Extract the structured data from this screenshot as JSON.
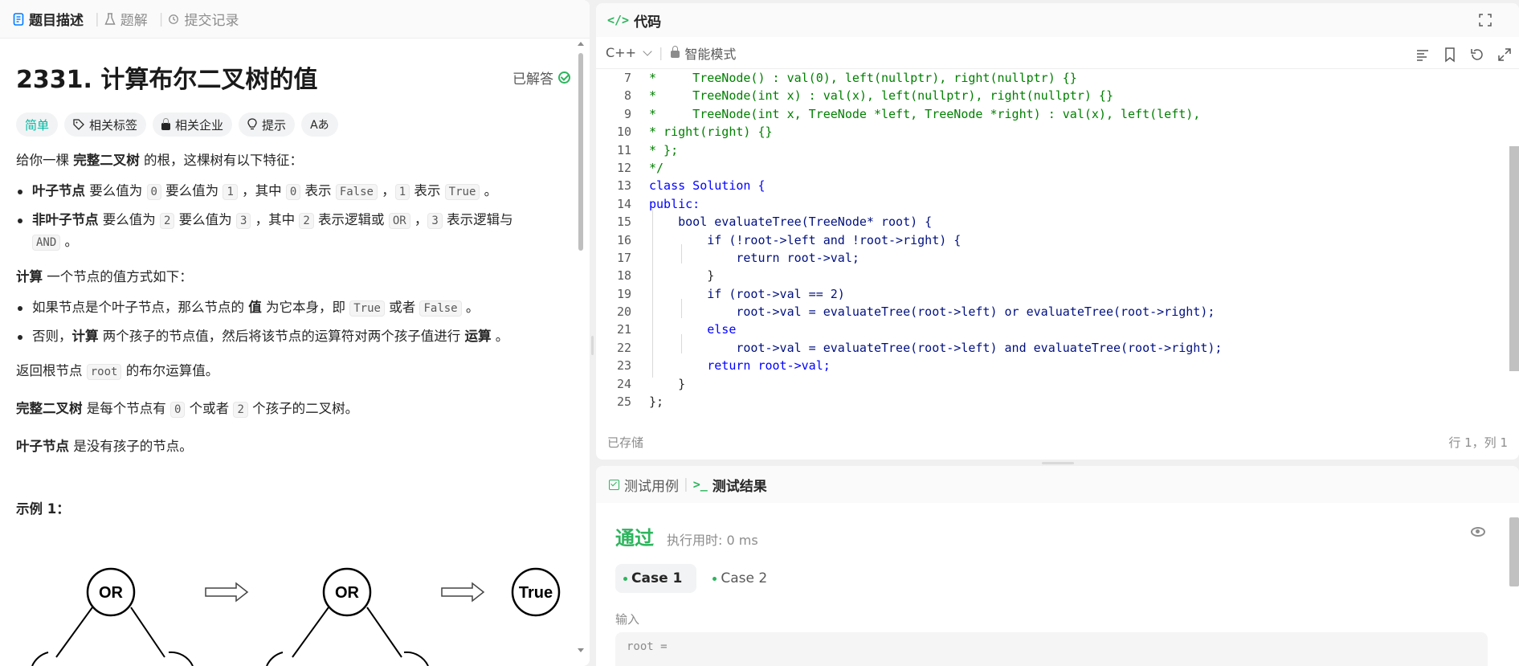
{
  "left_tabs": [
    {
      "label": "题目描述"
    },
    {
      "label": "题解"
    },
    {
      "label": "提交记录"
    }
  ],
  "problem": {
    "title": "2331. 计算布尔二叉树的值",
    "status": "已解答",
    "tags": [
      "简单",
      "相关标签",
      "相关企业",
      "提示",
      "Aあ"
    ],
    "intro_pre": "给你一棵 ",
    "intro_bold": "完整二叉树",
    "intro_post": " 的根，这棵树有以下特征：",
    "b1_bold": "叶子节点",
    "b1_t1": " 要么值为 ",
    "b1_c1": "0",
    "b1_t2": " 要么值为 ",
    "b1_c2": "1",
    "b1_t3": " ，其中 ",
    "b1_c3": "0",
    "b1_t4": " 表示 ",
    "b1_c4": "False",
    "b1_t5": " ，",
    "b1_c5": "1",
    "b1_t6": " 表示 ",
    "b1_c6": "True",
    "b1_t7": " 。",
    "b2_bold": "非叶子节点",
    "b2_t1": " 要么值为 ",
    "b2_c1": "2",
    "b2_t2": " 要么值为 ",
    "b2_c2": "3",
    "b2_t3": " ，其中 ",
    "b2_c3": "2",
    "b2_t4": " 表示逻辑或 ",
    "b2_c4": "OR",
    "b2_t5": " ，",
    "b2_c5": "3",
    "b2_t6": " 表示逻辑与 ",
    "b2_c6": "AND",
    "b2_t7": " 。",
    "calc_bold": "计算",
    "calc_post": " 一个节点的值方式如下：",
    "c1_t1": "如果节点是个叶子节点，那么节点的 ",
    "c1_bold": "值",
    "c1_t2": " 为它本身，即 ",
    "c1_c1": "True",
    "c1_t3": " 或者 ",
    "c1_c2": "False",
    "c1_t4": " 。",
    "c2_t1": "否则，",
    "c2_bold": "计算",
    "c2_t2": " 两个孩子的节点值，然后将该节点的运算符对两个孩子值进行 ",
    "c2_bold2": "运算",
    "c2_t3": " 。",
    "ret_t1": "返回根节点 ",
    "ret_c": "root",
    "ret_t2": " 的布尔运算值。",
    "full_bold": "完整二叉树",
    "full_t1": " 是每个节点有 ",
    "full_c1": "0",
    "full_t2": " 个或者 ",
    "full_c2": "2",
    "full_t3": " 个孩子的二叉树。",
    "leaf_bold": "叶子节点",
    "leaf_t1": " 是没有孩子的节点。",
    "example_title": "示例 1：",
    "diagram_nodes": [
      "OR",
      "OR",
      "True"
    ]
  },
  "code_panel": {
    "title": "代码",
    "language": "C++",
    "mode": "智能模式",
    "saved": "已存储",
    "cursor": "行 1，列 1",
    "lines": [
      {
        "n": "7",
        "text": "*     TreeNode() : val(0), left(nullptr), right(nullptr) {}"
      },
      {
        "n": "8",
        "text": "*     TreeNode(int x) : val(x), left(nullptr), right(nullptr) {}"
      },
      {
        "n": "9",
        "text": "*     TreeNode(int x, TreeNode *left, TreeNode *right) : val(x), left(left),"
      },
      {
        "n": "10",
        "text": "* right(right) {}"
      },
      {
        "n": "11",
        "text": "* };"
      },
      {
        "n": "12",
        "text": "*/"
      },
      {
        "n": "13",
        "text": "class Solution {"
      },
      {
        "n": "14",
        "text": "public:"
      },
      {
        "n": "15",
        "text": "    bool evaluateTree(TreeNode* root) {"
      },
      {
        "n": "16",
        "text": "        if (!root->left and !root->right) {"
      },
      {
        "n": "17",
        "text": "            return root->val;"
      },
      {
        "n": "18",
        "text": "        }"
      },
      {
        "n": "19",
        "text": "        if (root->val == 2)"
      },
      {
        "n": "20",
        "text": "            root->val = evaluateTree(root->left) or evaluateTree(root->right);"
      },
      {
        "n": "21",
        "text": "        else"
      },
      {
        "n": "22",
        "text": "            root->val = evaluateTree(root->left) and evaluateTree(root->right);"
      },
      {
        "n": "23",
        "text": "        return root->val;"
      },
      {
        "n": "24",
        "text": "    }"
      },
      {
        "n": "25",
        "text": "};"
      }
    ]
  },
  "test_panel": {
    "tabs": [
      "测试用例",
      "测试结果"
    ],
    "result": "通过",
    "runtime": "执行用时: 0 ms",
    "cases": [
      "Case 1",
      "Case 2"
    ],
    "input_label": "输入",
    "input_value": "root ="
  }
}
